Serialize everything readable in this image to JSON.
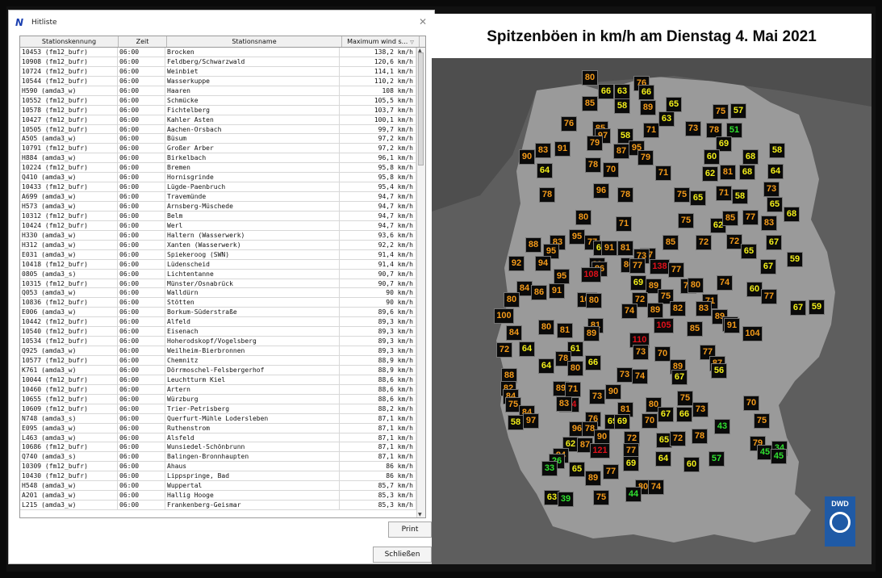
{
  "window": {
    "title": "Hitliste",
    "app_icon": "dwd-logo-icon",
    "close_icon": "close-icon"
  },
  "table": {
    "columns": [
      "Stationskennung",
      "Zeit",
      "Stationsname",
      "Maximum wind s..."
    ],
    "sort_icon": "sort-descending-icon",
    "rows": [
      {
        "id": "10453 (fm12_bufr)",
        "time": "06:00",
        "name": "Brocken",
        "value": "138,2  km/h"
      },
      {
        "id": "10908 (fm12_bufr)",
        "time": "06:00",
        "name": "Feldberg/Schwarzwald",
        "value": "120,6  km/h"
      },
      {
        "id": "10724 (fm12_bufr)",
        "time": "06:00",
        "name": "Weinbiet",
        "value": "114,1  km/h"
      },
      {
        "id": "10544 (fm12_bufr)",
        "time": "06:00",
        "name": "Wasserkuppe",
        "value": "110,2  km/h"
      },
      {
        "id": "H590 (amda3_w)",
        "time": "06:00",
        "name": "Haaren",
        "value": "108  km/h"
      },
      {
        "id": "10552 (fm12_bufr)",
        "time": "06:00",
        "name": "Schmücke",
        "value": "105,5  km/h"
      },
      {
        "id": "10578 (fm12_bufr)",
        "time": "06:00",
        "name": "Fichtelberg",
        "value": "103,7  km/h"
      },
      {
        "id": "10427 (fm12_bufr)",
        "time": "06:00",
        "name": "Kahler Asten",
        "value": "100,1  km/h"
      },
      {
        "id": "10505 (fm12_bufr)",
        "time": "06:00",
        "name": "Aachen-Orsbach",
        "value": "99,7  km/h"
      },
      {
        "id": "A505 (amda3_w)",
        "time": "06:00",
        "name": "Büsum",
        "value": "97,2  km/h"
      },
      {
        "id": "10791 (fm12_bufr)",
        "time": "06:00",
        "name": "Großer Arber",
        "value": "97,2  km/h"
      },
      {
        "id": "H884 (amda3_w)",
        "time": "06:00",
        "name": "Birkelbach",
        "value": "96,1  km/h"
      },
      {
        "id": "10224 (fm12_bufr)",
        "time": "06:00",
        "name": "Bremen",
        "value": "95,8  km/h"
      },
      {
        "id": "Q410 (amda3_w)",
        "time": "06:00",
        "name": "Hornisgrinde",
        "value": "95,8  km/h"
      },
      {
        "id": "10433 (fm12_bufr)",
        "time": "06:00",
        "name": "Lügde-Paenbruch",
        "value": "95,4  km/h"
      },
      {
        "id": "A699 (amda3_w)",
        "time": "06:00",
        "name": "Travemünde",
        "value": "94,7  km/h"
      },
      {
        "id": "H573 (amda3_w)",
        "time": "06:00",
        "name": "Arnsberg-Müschede",
        "value": "94,7  km/h"
      },
      {
        "id": "10312 (fm12_bufr)",
        "time": "06:00",
        "name": "Belm",
        "value": "94,7  km/h"
      },
      {
        "id": "10424 (fm12_bufr)",
        "time": "06:00",
        "name": "Werl",
        "value": "94,7  km/h"
      },
      {
        "id": "H330 (amda3_w)",
        "time": "06:00",
        "name": "Haltern (Wasserwerk)",
        "value": "93,6  km/h"
      },
      {
        "id": "H312 (amda3_w)",
        "time": "06:00",
        "name": "Xanten (Wasserwerk)",
        "value": "92,2  km/h"
      },
      {
        "id": "E031 (amda3_w)",
        "time": "06:00",
        "name": "Spiekeroog (SWN)",
        "value": "91,4  km/h"
      },
      {
        "id": "10418 (fm12_bufr)",
        "time": "06:00",
        "name": "Lüdenscheid",
        "value": "91,4  km/h"
      },
      {
        "id": "0805 (amda3_s)",
        "time": "06:00",
        "name": "Lichtentanne",
        "value": "90,7  km/h"
      },
      {
        "id": "10315 (fm12_bufr)",
        "time": "06:00",
        "name": "Münster/Osnabrück",
        "value": "90,7  km/h"
      },
      {
        "id": "Q053 (amda3_w)",
        "time": "06:00",
        "name": "Walldürn",
        "value": "90  km/h"
      },
      {
        "id": "10836 (fm12_bufr)",
        "time": "06:00",
        "name": "Stötten",
        "value": "90  km/h"
      },
      {
        "id": "E006 (amda3_w)",
        "time": "06:00",
        "name": "Borkum-Süderstraße",
        "value": "89,6  km/h"
      },
      {
        "id": "10442 (fm12_bufr)",
        "time": "06:00",
        "name": "Alfeld",
        "value": "89,3  km/h"
      },
      {
        "id": "10540 (fm12_bufr)",
        "time": "06:00",
        "name": "Eisenach",
        "value": "89,3  km/h"
      },
      {
        "id": "10534 (fm12_bufr)",
        "time": "06:00",
        "name": "Hoherodskopf/Vogelsberg",
        "value": "89,3  km/h"
      },
      {
        "id": "Q925 (amda3_w)",
        "time": "06:00",
        "name": "Weilheim-Bierbronnen",
        "value": "89,3  km/h"
      },
      {
        "id": "10577 (fm12_bufr)",
        "time": "06:00",
        "name": "Chemnitz",
        "value": "88,9  km/h"
      },
      {
        "id": "K761 (amda3_w)",
        "time": "06:00",
        "name": "Dörrmoschel-Felsbergerhof",
        "value": "88,9  km/h"
      },
      {
        "id": "10044 (fm12_bufr)",
        "time": "06:00",
        "name": "Leuchtturm Kiel",
        "value": "88,6  km/h"
      },
      {
        "id": "10460 (fm12_bufr)",
        "time": "06:00",
        "name": "Artern",
        "value": "88,6  km/h"
      },
      {
        "id": "10655 (fm12_bufr)",
        "time": "06:00",
        "name": "Würzburg",
        "value": "88,6  km/h"
      },
      {
        "id": "10609 (fm12_bufr)",
        "time": "06:00",
        "name": "Trier-Petrisberg",
        "value": "88,2  km/h"
      },
      {
        "id": "N748 (amda3_s)",
        "time": "06:00",
        "name": "Querfurt-Mühle Lodersleben",
        "value": "87,1  km/h"
      },
      {
        "id": "E095 (amda3_w)",
        "time": "06:00",
        "name": "Ruthenstrom",
        "value": "87,1  km/h"
      },
      {
        "id": "L463 (amda3_w)",
        "time": "06:00",
        "name": "Alsfeld",
        "value": "87,1  km/h"
      },
      {
        "id": "10686 (fm12_bufr)",
        "time": "06:00",
        "name": "Wunsiedel-Schönbrunn",
        "value": "87,1  km/h"
      },
      {
        "id": "Q740 (amda3_s)",
        "time": "06:00",
        "name": "Balingen-Bronnhaupten",
        "value": "87,1  km/h"
      },
      {
        "id": "10309 (fm12_bufr)",
        "time": "06:00",
        "name": "Ahaus",
        "value": "86  km/h"
      },
      {
        "id": "10430 (fm12_bufr)",
        "time": "06:00",
        "name": "Lippspringe, Bad",
        "value": "86  km/h"
      },
      {
        "id": "H548 (amda3_w)",
        "time": "06:00",
        "name": "Wuppertal",
        "value": "85,7  km/h"
      },
      {
        "id": "A201 (amda3_w)",
        "time": "06:00",
        "name": "Hallig Hooge",
        "value": "85,3  km/h"
      },
      {
        "id": "L215 (amda3_w)",
        "time": "06:00",
        "name": "Frankenberg-Geismar",
        "value": "85,3  km/h"
      }
    ]
  },
  "buttons": {
    "print": "Print",
    "close": "Schließen"
  },
  "map": {
    "title": "Spitzenböen in km/h am Dienstag 4. Mai 2021",
    "logo_text": "DWD",
    "colors": {
      "red": "#e0101a",
      "orange": "#f39a1a",
      "yellow": "#f2ee1a",
      "green": "#30e030"
    },
    "markers": [
      {
        "v": "80",
        "c": "orange"
      },
      {
        "v": "66",
        "c": "yellow"
      },
      {
        "v": "63",
        "c": "yellow"
      },
      {
        "v": "76",
        "c": "orange"
      },
      {
        "v": "85",
        "c": "orange"
      },
      {
        "v": "58",
        "c": "yellow"
      },
      {
        "v": "66",
        "c": "yellow"
      },
      {
        "v": "89",
        "c": "orange"
      },
      {
        "v": "65",
        "c": "yellow"
      },
      {
        "v": "75",
        "c": "orange"
      },
      {
        "v": "57",
        "c": "yellow"
      },
      {
        "v": "76",
        "c": "orange"
      },
      {
        "v": "85",
        "c": "orange"
      },
      {
        "v": "97",
        "c": "orange"
      },
      {
        "v": "58",
        "c": "yellow"
      },
      {
        "v": "71",
        "c": "orange"
      },
      {
        "v": "63",
        "c": "yellow"
      },
      {
        "v": "73",
        "c": "orange"
      },
      {
        "v": "78",
        "c": "orange"
      },
      {
        "v": "51",
        "c": "green"
      },
      {
        "v": "79",
        "c": "orange"
      },
      {
        "v": "95",
        "c": "orange"
      },
      {
        "v": "69",
        "c": "yellow"
      },
      {
        "v": "58",
        "c": "yellow"
      },
      {
        "v": "90",
        "c": "orange"
      },
      {
        "v": "83",
        "c": "orange"
      },
      {
        "v": "91",
        "c": "orange"
      },
      {
        "v": "87",
        "c": "orange"
      },
      {
        "v": "79",
        "c": "orange"
      },
      {
        "v": "60",
        "c": "yellow"
      },
      {
        "v": "68",
        "c": "yellow"
      },
      {
        "v": "64",
        "c": "yellow"
      },
      {
        "v": "78",
        "c": "orange"
      },
      {
        "v": "70",
        "c": "orange"
      },
      {
        "v": "71",
        "c": "orange"
      },
      {
        "v": "62",
        "c": "yellow"
      },
      {
        "v": "81",
        "c": "orange"
      },
      {
        "v": "68",
        "c": "yellow"
      },
      {
        "v": "64",
        "c": "yellow"
      },
      {
        "v": "78",
        "c": "orange"
      },
      {
        "v": "96",
        "c": "orange"
      },
      {
        "v": "78",
        "c": "orange"
      },
      {
        "v": "75",
        "c": "orange"
      },
      {
        "v": "65",
        "c": "yellow"
      },
      {
        "v": "71",
        "c": "orange"
      },
      {
        "v": "58",
        "c": "yellow"
      },
      {
        "v": "73",
        "c": "orange"
      },
      {
        "v": "65",
        "c": "yellow"
      },
      {
        "v": "80",
        "c": "orange"
      },
      {
        "v": "71",
        "c": "orange"
      },
      {
        "v": "75",
        "c": "orange"
      },
      {
        "v": "62",
        "c": "yellow"
      },
      {
        "v": "85",
        "c": "orange"
      },
      {
        "v": "77",
        "c": "orange"
      },
      {
        "v": "83",
        "c": "orange"
      },
      {
        "v": "67",
        "c": "yellow"
      },
      {
        "v": "68",
        "c": "yellow"
      },
      {
        "v": "95",
        "c": "orange"
      },
      {
        "v": "83",
        "c": "orange"
      },
      {
        "v": "77",
        "c": "orange"
      },
      {
        "v": "68",
        "c": "yellow"
      },
      {
        "v": "81",
        "c": "orange"
      },
      {
        "v": "86",
        "c": "orange"
      },
      {
        "v": "91",
        "c": "orange"
      },
      {
        "v": "77",
        "c": "orange"
      },
      {
        "v": "85",
        "c": "orange"
      },
      {
        "v": "72",
        "c": "orange"
      },
      {
        "v": "72",
        "c": "orange"
      },
      {
        "v": "88",
        "c": "orange"
      },
      {
        "v": "95",
        "c": "orange"
      },
      {
        "v": "89",
        "c": "orange"
      },
      {
        "v": "73",
        "c": "orange"
      },
      {
        "v": "65",
        "c": "yellow"
      },
      {
        "v": "59",
        "c": "yellow"
      },
      {
        "v": "92",
        "c": "orange"
      },
      {
        "v": "94",
        "c": "orange"
      },
      {
        "v": "86",
        "c": "orange"
      },
      {
        "v": "77",
        "c": "orange"
      },
      {
        "v": "138",
        "c": "red"
      },
      {
        "v": "77",
        "c": "orange"
      },
      {
        "v": "67",
        "c": "yellow"
      },
      {
        "v": "95",
        "c": "orange"
      },
      {
        "v": "108",
        "c": "red"
      },
      {
        "v": "84",
        "c": "orange"
      },
      {
        "v": "86",
        "c": "orange"
      },
      {
        "v": "91",
        "c": "orange"
      },
      {
        "v": "69",
        "c": "yellow"
      },
      {
        "v": "89",
        "c": "orange"
      },
      {
        "v": "77",
        "c": "orange"
      },
      {
        "v": "80",
        "c": "orange"
      },
      {
        "v": "74",
        "c": "orange"
      },
      {
        "v": "60",
        "c": "yellow"
      },
      {
        "v": "80",
        "c": "orange"
      },
      {
        "v": "100",
        "c": "orange"
      },
      {
        "v": "72",
        "c": "orange"
      },
      {
        "v": "75",
        "c": "orange"
      },
      {
        "v": "77",
        "c": "orange"
      },
      {
        "v": "71",
        "c": "orange"
      },
      {
        "v": "67",
        "c": "yellow"
      },
      {
        "v": "59",
        "c": "yellow"
      },
      {
        "v": "100",
        "c": "orange"
      },
      {
        "v": "80",
        "c": "orange"
      },
      {
        "v": "81",
        "c": "orange"
      },
      {
        "v": "74",
        "c": "orange"
      },
      {
        "v": "89",
        "c": "orange"
      },
      {
        "v": "82",
        "c": "orange"
      },
      {
        "v": "83",
        "c": "orange"
      },
      {
        "v": "89",
        "c": "orange"
      },
      {
        "v": "76",
        "c": "orange"
      },
      {
        "v": "84",
        "c": "orange"
      },
      {
        "v": "80",
        "c": "orange"
      },
      {
        "v": "81",
        "c": "orange"
      },
      {
        "v": "89",
        "c": "orange"
      },
      {
        "v": "110",
        "c": "red"
      },
      {
        "v": "105",
        "c": "red"
      },
      {
        "v": "85",
        "c": "orange"
      },
      {
        "v": "91",
        "c": "orange"
      },
      {
        "v": "104",
        "c": "orange"
      },
      {
        "v": "72",
        "c": "orange"
      },
      {
        "v": "64",
        "c": "yellow"
      },
      {
        "v": "61",
        "c": "yellow"
      },
      {
        "v": "66",
        "c": "yellow"
      },
      {
        "v": "73",
        "c": "orange"
      },
      {
        "v": "70",
        "c": "orange"
      },
      {
        "v": "77",
        "c": "orange"
      },
      {
        "v": "87",
        "c": "orange"
      },
      {
        "v": "78",
        "c": "orange"
      },
      {
        "v": "80",
        "c": "orange"
      },
      {
        "v": "64",
        "c": "yellow"
      },
      {
        "v": "88",
        "c": "orange"
      },
      {
        "v": "73",
        "c": "orange"
      },
      {
        "v": "89",
        "c": "orange"
      },
      {
        "v": "56",
        "c": "yellow"
      },
      {
        "v": "82",
        "c": "orange"
      },
      {
        "v": "84",
        "c": "orange"
      },
      {
        "v": "89",
        "c": "orange"
      },
      {
        "v": "90",
        "c": "orange"
      },
      {
        "v": "74",
        "c": "orange"
      },
      {
        "v": "67",
        "c": "yellow"
      },
      {
        "v": "70",
        "c": "orange"
      },
      {
        "v": "75",
        "c": "orange"
      },
      {
        "v": "84",
        "c": "orange"
      },
      {
        "v": "114",
        "c": "red"
      },
      {
        "v": "71",
        "c": "orange"
      },
      {
        "v": "73",
        "c": "orange"
      },
      {
        "v": "80",
        "c": "orange"
      },
      {
        "v": "75",
        "c": "orange"
      },
      {
        "v": "58",
        "c": "yellow"
      },
      {
        "v": "97",
        "c": "orange"
      },
      {
        "v": "83",
        "c": "orange"
      },
      {
        "v": "76",
        "c": "orange"
      },
      {
        "v": "81",
        "c": "orange"
      },
      {
        "v": "67",
        "c": "yellow"
      },
      {
        "v": "66",
        "c": "yellow"
      },
      {
        "v": "73",
        "c": "orange"
      },
      {
        "v": "75",
        "c": "orange"
      },
      {
        "v": "96",
        "c": "orange"
      },
      {
        "v": "78",
        "c": "orange"
      },
      {
        "v": "90",
        "c": "orange"
      },
      {
        "v": "69",
        "c": "yellow"
      },
      {
        "v": "69",
        "c": "yellow"
      },
      {
        "v": "70",
        "c": "orange"
      },
      {
        "v": "43",
        "c": "green"
      },
      {
        "v": "62",
        "c": "yellow"
      },
      {
        "v": "87",
        "c": "orange"
      },
      {
        "v": "72",
        "c": "orange"
      },
      {
        "v": "65",
        "c": "yellow"
      },
      {
        "v": "72",
        "c": "orange"
      },
      {
        "v": "78",
        "c": "orange"
      },
      {
        "v": "79",
        "c": "orange"
      },
      {
        "v": "45",
        "c": "green"
      },
      {
        "v": "34",
        "c": "green"
      },
      {
        "v": "84",
        "c": "orange"
      },
      {
        "v": "121",
        "c": "red"
      },
      {
        "v": "77",
        "c": "orange"
      },
      {
        "v": "69",
        "c": "yellow"
      },
      {
        "v": "64",
        "c": "yellow"
      },
      {
        "v": "57",
        "c": "green"
      },
      {
        "v": "45",
        "c": "green"
      },
      {
        "v": "26",
        "c": "green"
      },
      {
        "v": "65",
        "c": "yellow"
      },
      {
        "v": "89",
        "c": "orange"
      },
      {
        "v": "77",
        "c": "orange"
      },
      {
        "v": "80",
        "c": "orange"
      },
      {
        "v": "74",
        "c": "orange"
      },
      {
        "v": "60",
        "c": "yellow"
      },
      {
        "v": "33",
        "c": "green"
      },
      {
        "v": "63",
        "c": "yellow"
      },
      {
        "v": "39",
        "c": "green"
      },
      {
        "v": "75",
        "c": "orange"
      },
      {
        "v": "44",
        "c": "green"
      }
    ]
  }
}
